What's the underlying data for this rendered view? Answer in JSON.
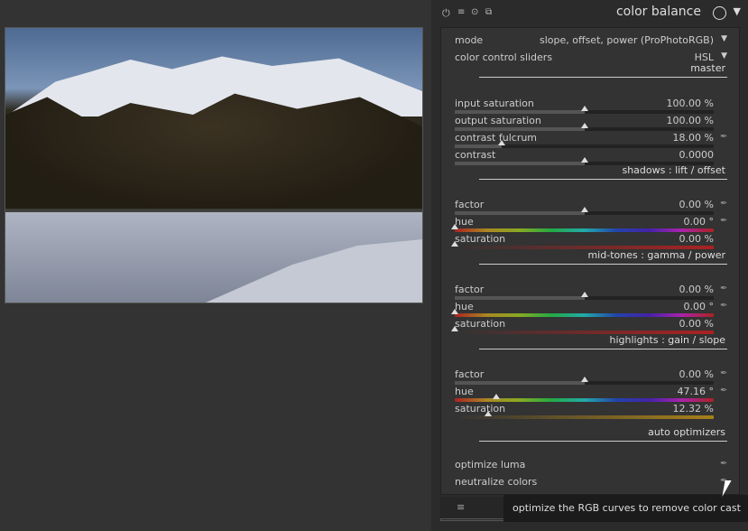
{
  "module": {
    "title": "color balance",
    "header_icons": [
      "power-icon",
      "multi-instance-icon",
      "reset-icon",
      "presets-icon"
    ],
    "mode": {
      "label": "mode",
      "value": "slope, offset, power (ProPhotoRGB)"
    },
    "color_control_sliders": {
      "label": "color control sliders",
      "value": "HSL"
    },
    "sections": [
      {
        "title": "master",
        "sliders": [
          {
            "label": "input saturation",
            "value": "100.00 %",
            "pos": 0.5,
            "picker": false,
            "kind": "neutral"
          },
          {
            "label": "output saturation",
            "value": "100.00 %",
            "pos": 0.5,
            "picker": false,
            "kind": "neutral"
          },
          {
            "label": "contrast fulcrum",
            "value": "18.00 %",
            "pos": 0.18,
            "picker": true,
            "kind": "neutral"
          },
          {
            "label": "contrast",
            "value": "0.0000",
            "pos": 0.5,
            "picker": false,
            "kind": "neutral"
          }
        ]
      },
      {
        "title": "shadows : lift / offset",
        "sliders": [
          {
            "label": "factor",
            "value": "0.00 %",
            "pos": 0.5,
            "picker": true,
            "kind": "neutral"
          },
          {
            "label": "hue",
            "value": "0.00 °",
            "pos": 0.0,
            "picker": true,
            "kind": "hue"
          },
          {
            "label": "saturation",
            "value": "0.00 %",
            "pos": 0.0,
            "picker": false,
            "kind": "satS"
          }
        ]
      },
      {
        "title": "mid-tones : gamma / power",
        "sliders": [
          {
            "label": "factor",
            "value": "0.00 %",
            "pos": 0.5,
            "picker": true,
            "kind": "neutral"
          },
          {
            "label": "hue",
            "value": "0.00 °",
            "pos": 0.0,
            "picker": true,
            "kind": "hue"
          },
          {
            "label": "saturation",
            "value": "0.00 %",
            "pos": 0.0,
            "picker": false,
            "kind": "satS"
          }
        ]
      },
      {
        "title": "highlights : gain / slope",
        "sliders": [
          {
            "label": "factor",
            "value": "0.00 %",
            "pos": 0.5,
            "picker": true,
            "kind": "neutral"
          },
          {
            "label": "hue",
            "value": "47.16 °",
            "pos": 0.16,
            "picker": true,
            "kind": "hue"
          },
          {
            "label": "saturation",
            "value": "12.32 %",
            "pos": 0.13,
            "picker": false,
            "kind": "satH"
          }
        ]
      }
    ],
    "auto_optimizers": {
      "title": "auto optimizers",
      "items": [
        "optimize luma",
        "neutralize colors"
      ]
    }
  },
  "tooltip": "optimize the RGB curves to remove color cast"
}
